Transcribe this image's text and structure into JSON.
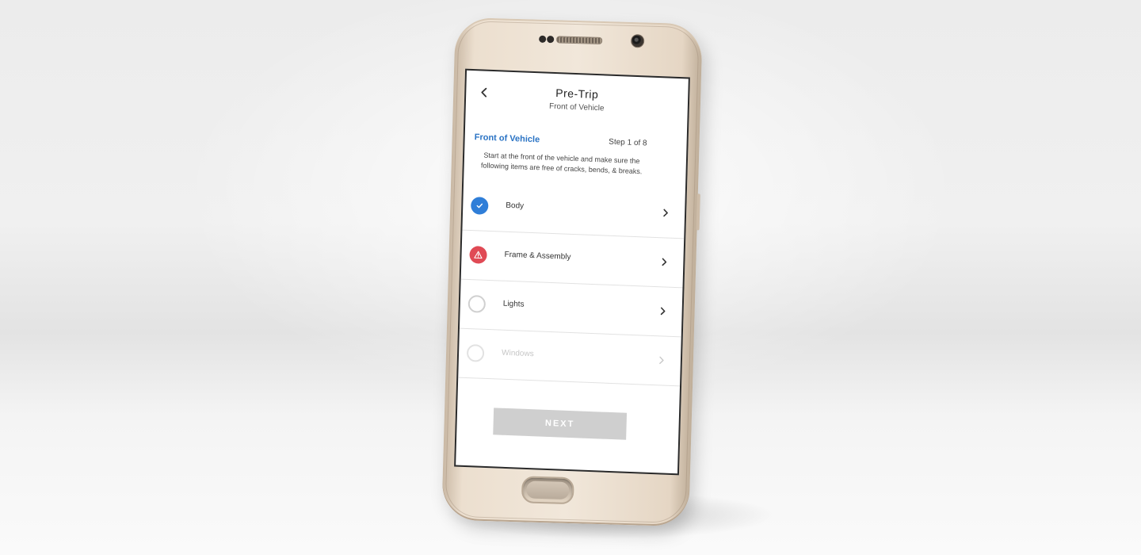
{
  "header": {
    "title": "Pre-Trip",
    "subtitle": "Front of Vehicle",
    "back_icon": "chevron-left-icon"
  },
  "section": {
    "title": "Front of Vehicle",
    "step": "Step 1 of 8",
    "instructions": "Start at the front of the vehicle and make sure the following items are free of cracks, bends, & breaks."
  },
  "checklist": [
    {
      "label": "Body",
      "status": "complete",
      "status_icon": "check-icon",
      "color": "#2f7ed8"
    },
    {
      "label": "Frame & Assembly",
      "status": "warning",
      "status_icon": "warning-icon",
      "color": "#e04a55"
    },
    {
      "label": "Lights",
      "status": "pending",
      "status_icon": "empty-circle-icon"
    },
    {
      "label": "Windows",
      "status": "disabled",
      "status_icon": "empty-circle-icon"
    }
  ],
  "footer": {
    "next_label": "NEXT"
  },
  "colors": {
    "accent": "#2a73c4",
    "complete": "#2f7ed8",
    "warning": "#e04a55",
    "button_disabled": "#cfcfcf"
  }
}
